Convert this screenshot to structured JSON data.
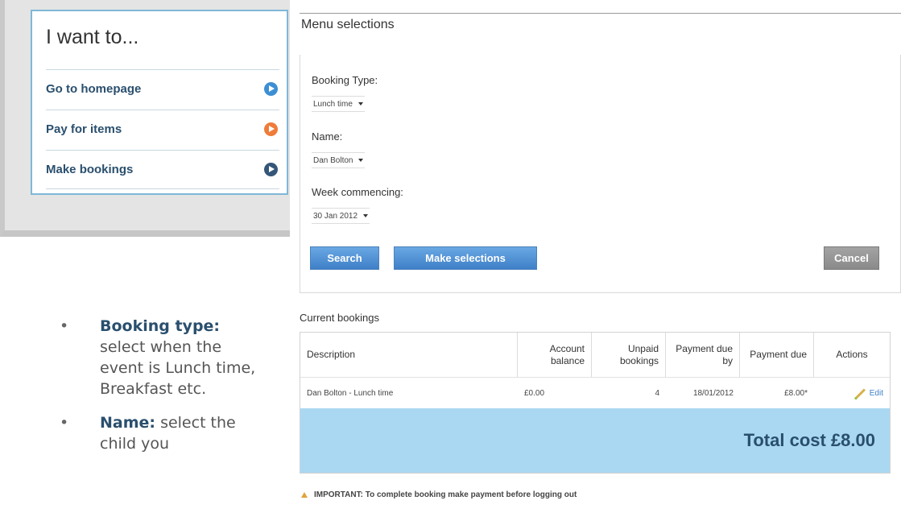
{
  "iwant": {
    "title": "I want to...",
    "items": [
      {
        "label": "Go to homepage",
        "icon": "arrow-right-circle-blue-icon",
        "color": "#3d8fd4"
      },
      {
        "label": "Pay for items",
        "icon": "arrow-right-circle-orange-icon",
        "color": "#ef7c3a"
      },
      {
        "label": "Make bookings",
        "icon": "arrow-right-circle-dark-icon",
        "color": "#355679"
      }
    ]
  },
  "bullets": [
    {
      "term": "Booking type:",
      "text": "select when the event is Lunch time, Breakfast etc."
    },
    {
      "term": "Name:",
      "text": "select the child you"
    }
  ],
  "menu": {
    "title": "Menu selections",
    "booking_type_label": "Booking Type:",
    "booking_type_value": "Lunch time",
    "name_label": "Name:",
    "name_value": "Dan Bolton",
    "week_label": "Week commencing:",
    "week_value": "30 Jan 2012",
    "search_label": "Search",
    "make_selections_label": "Make selections",
    "cancel_label": "Cancel"
  },
  "bookings": {
    "title": "Current bookings",
    "columns": [
      "Description",
      "Account balance",
      "Unpaid bookings",
      "Payment due by",
      "Payment due",
      "Actions"
    ],
    "rows": [
      {
        "description": "Dan Bolton - Lunch time",
        "account_balance": "£0.00",
        "unpaid_bookings": "4",
        "payment_due_by": "18/01/2012",
        "payment_due": "£8.00*",
        "action": "Edit"
      }
    ],
    "total": "Total cost £8.00",
    "important": "IMPORTANT: To complete booking make payment before logging out"
  }
}
